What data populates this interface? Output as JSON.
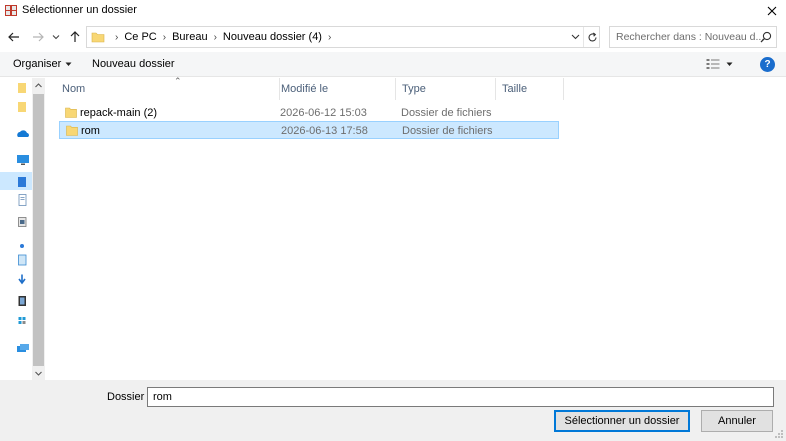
{
  "window": {
    "title": "Sélectionner un dossier"
  },
  "address": {
    "crumbs": [
      "Ce PC",
      "Bureau",
      "Nouveau dossier (4)"
    ]
  },
  "search": {
    "placeholder": "Rechercher dans : Nouveau d..."
  },
  "toolbar": {
    "organize_label": "Organiser",
    "new_folder_label": "Nouveau dossier"
  },
  "columns": {
    "name": "Nom",
    "modified": "Modifié le",
    "type": "Type",
    "size": "Taille"
  },
  "files": [
    {
      "name": "repack-main (2)",
      "modified": "2026-06-12 15:03",
      "type": "Dossier de fichiers",
      "selected": false
    },
    {
      "name": "rom",
      "modified": "2026-06-13 17:58",
      "type": "Dossier de fichiers",
      "selected": true
    }
  ],
  "footer": {
    "folder_label": "Dossier :",
    "folder_value": "rom",
    "select_button": "Sélectionner un dossier",
    "cancel_button": "Annuler"
  },
  "colors": {
    "selection_bg": "#cce8ff",
    "selection_border": "#99d1ff",
    "accent": "#0078d7",
    "help": "#1a6dcd",
    "folder": "#f8d775"
  }
}
